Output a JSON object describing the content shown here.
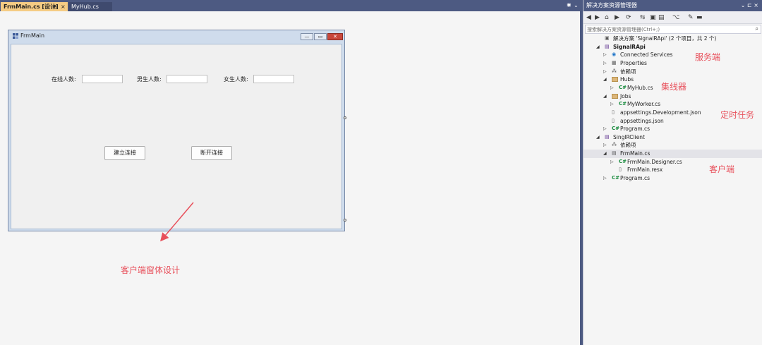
{
  "tabs": [
    {
      "label": "FrmMain.cs [设计]",
      "pin": "⊕",
      "close": "×"
    },
    {
      "label": "MyHub.cs"
    }
  ],
  "strip_buttons": {
    "settings": "✱",
    "dropdown": "⌄"
  },
  "form": {
    "title": "FrmMain",
    "labels": [
      "在线人数:",
      "男生人数:",
      "女生人数:"
    ],
    "buttons": [
      "建立连接",
      "断开连接"
    ],
    "window_buttons": {
      "min": "—",
      "max": "▭",
      "close": "✕"
    }
  },
  "solution_explorer": {
    "title": "解决方案资源管理器",
    "title_buttons": "⌄ ⊏ ×",
    "search_placeholder": "搜索解决方案资源管理器(Ctrl+;)",
    "search_icon": "⌕",
    "toolbar_glyphs": [
      "◀",
      "▶",
      "⌂",
      "▶",
      "⟳",
      "⇆",
      "▣",
      "▤",
      "⌥",
      "✎",
      "▬"
    ],
    "tree": [
      {
        "indent": 0,
        "expander": "",
        "icon": "sln",
        "label": "解决方案 'SignalRApi' (2 个项目，共 2 个)",
        "bold": false
      },
      {
        "indent": 0,
        "expander": "◢",
        "icon": "proj",
        "label": "SignalRApi",
        "bold": true
      },
      {
        "indent": 1,
        "expander": "▷",
        "icon": "svc",
        "label": "Connected Services",
        "bold": false
      },
      {
        "indent": 1,
        "expander": "▷",
        "icon": "prop",
        "label": "Properties",
        "bold": false
      },
      {
        "indent": 1,
        "expander": "▷",
        "icon": "dep",
        "label": "依赖项",
        "bold": false
      },
      {
        "indent": 1,
        "expander": "◢",
        "icon": "folder",
        "label": "Hubs",
        "bold": false
      },
      {
        "indent": 2,
        "expander": "▷",
        "icon": "cs",
        "label": "MyHub.cs",
        "bold": false
      },
      {
        "indent": 1,
        "expander": "◢",
        "icon": "folder",
        "label": "Jobs",
        "bold": false
      },
      {
        "indent": 2,
        "expander": "▷",
        "icon": "cs",
        "label": "MyWorker.cs",
        "bold": false
      },
      {
        "indent": 1,
        "expander": "",
        "icon": "json",
        "label": "appsettings.Development.json",
        "bold": false
      },
      {
        "indent": 1,
        "expander": "",
        "icon": "json",
        "label": "appsettings.json",
        "bold": false
      },
      {
        "indent": 1,
        "expander": "▷",
        "icon": "cs",
        "label": "Program.cs",
        "bold": false
      },
      {
        "indent": 0,
        "expander": "◢",
        "icon": "proj",
        "label": "SinglRClient",
        "bold": false
      },
      {
        "indent": 1,
        "expander": "▷",
        "icon": "dep",
        "label": "依赖项",
        "bold": false
      },
      {
        "indent": 1,
        "expander": "◢",
        "icon": "form",
        "label": "FrmMain.cs",
        "bold": false,
        "selected": true
      },
      {
        "indent": 2,
        "expander": "▷",
        "icon": "cs",
        "label": "FrmMain.Designer.cs",
        "bold": false
      },
      {
        "indent": 2,
        "expander": "",
        "icon": "resx",
        "label": "FrmMain.resx",
        "bold": false
      },
      {
        "indent": 1,
        "expander": "▷",
        "icon": "cs",
        "label": "Program.cs",
        "bold": false
      }
    ],
    "cs_glyph": "C#"
  },
  "annotations": {
    "server": "服务端",
    "hub": "集线器",
    "timer": "定时任务",
    "client": "客户端",
    "design": "客户端窗体设计"
  },
  "colors": {
    "accent": "#4d5a82",
    "annotation": "#e8505b",
    "active_tab": "#f5cc84"
  }
}
